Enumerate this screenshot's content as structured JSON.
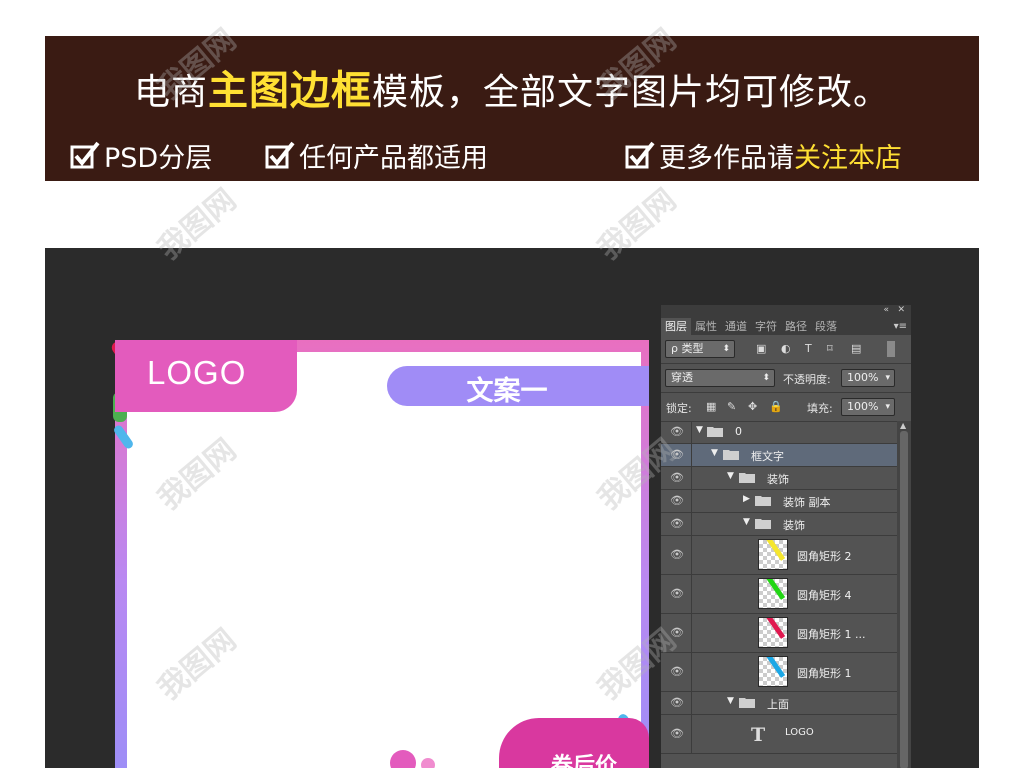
{
  "banner": {
    "title_prefix": "电商",
    "title_highlight": "主图边框",
    "title_suffix": "模板，全部文字图片均可修改。",
    "features": [
      {
        "text": "PSD分层"
      },
      {
        "text": "任何产品都适用"
      },
      {
        "text_prefix": "更多作品请",
        "text_highlight": "关注本店"
      }
    ]
  },
  "poster": {
    "logo_text": "LOGO",
    "pill_text": "文案一",
    "bottom_text": "卷后价"
  },
  "panel": {
    "tabs": [
      "图层",
      "属性",
      "通道",
      "字符",
      "路径",
      "段落"
    ],
    "filter_label": "ρ 类型",
    "blend_mode": "穿透",
    "opacity_label": "不透明度:",
    "opacity_value": "100%",
    "lock_label": "锁定:",
    "fill_label": "填充:",
    "fill_value": "100%",
    "layers": [
      {
        "name": "0",
        "kind": "group",
        "expanded": true
      },
      {
        "name": "框文字",
        "kind": "group",
        "expanded": true
      },
      {
        "name": "装饰",
        "kind": "group",
        "expanded": true
      },
      {
        "name": "装饰 副本",
        "kind": "group",
        "expanded": false
      },
      {
        "name": "装饰",
        "kind": "group",
        "expanded": true
      },
      {
        "name": "圆角矩形 2",
        "kind": "shape",
        "swatch": "#f5e62e"
      },
      {
        "name": "圆角矩形 4",
        "kind": "shape",
        "swatch": "#22d614"
      },
      {
        "name": "圆角矩形 1 ...",
        "kind": "shape",
        "swatch": "#e0184f"
      },
      {
        "name": "圆角矩形 1",
        "kind": "shape",
        "swatch": "#1aa7e6"
      },
      {
        "name": "上面",
        "kind": "group",
        "expanded": true
      },
      {
        "name": "LOGO",
        "kind": "text"
      }
    ]
  },
  "colors": {
    "banner_bg": "#3a1b13",
    "highlight": "#ffe033",
    "canvas_bg": "#2b2b2b",
    "logo_pink": "#e35bbd",
    "pill_purple": "#a08cf6"
  },
  "watermark": "我图网"
}
